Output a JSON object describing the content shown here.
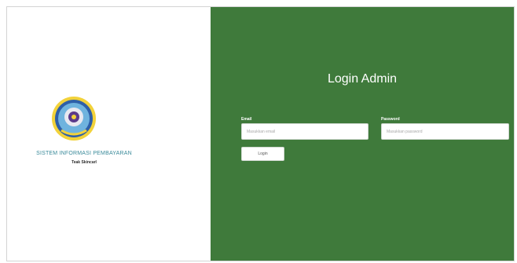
{
  "brand": {
    "logo_icon": "university-seal-icon",
    "app_name": "SISTEM INFORMASI PEMBAYARAN",
    "subtitle": "Teak Skincarl"
  },
  "login": {
    "title": "Login Admin",
    "email_label": "Email",
    "email_placeholder": "Masukkan email",
    "password_label": "Password",
    "password_placeholder": "Masukkan password",
    "button_label": "Login"
  },
  "colors": {
    "panel_green": "#3f7a3b",
    "brand_teal": "#3a8a9a",
    "seal_blue": "#2e5fa8",
    "seal_yellow": "#f2d23a"
  }
}
